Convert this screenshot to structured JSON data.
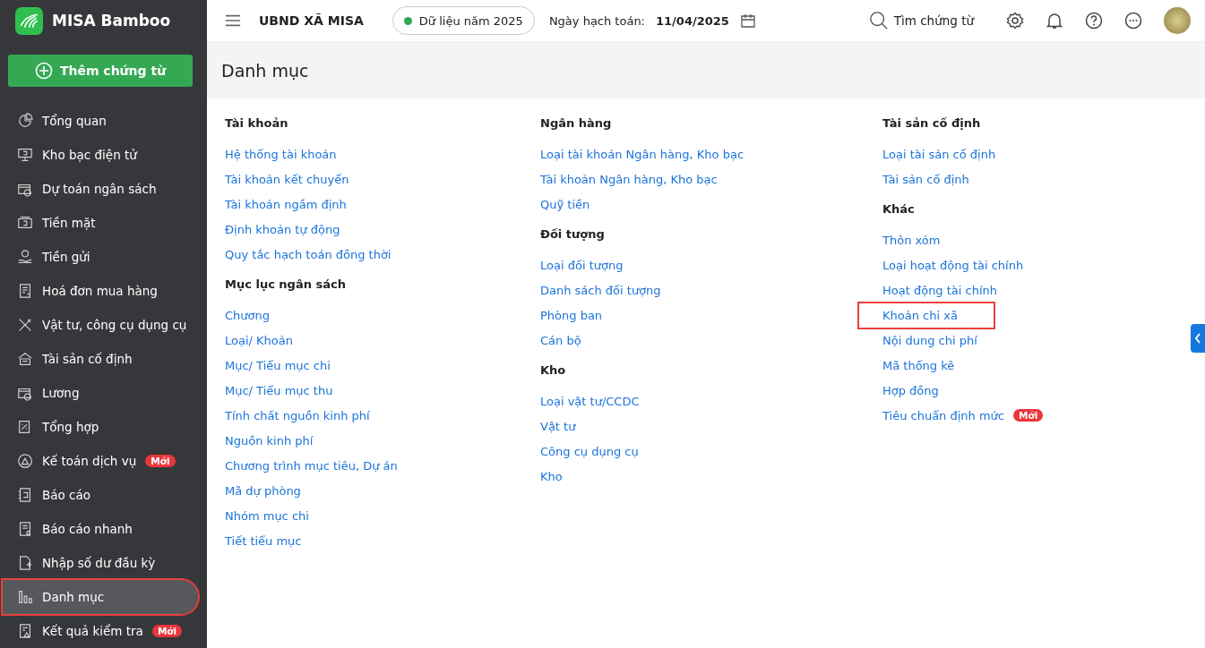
{
  "brand": {
    "name": "MISA Bamboo"
  },
  "add_button": {
    "label": "Thêm chứng từ"
  },
  "sidebar": {
    "items": [
      {
        "label": "Tổng quan",
        "selected": false,
        "highlighted": false
      },
      {
        "label": "Kho bạc điện tử",
        "selected": false,
        "highlighted": false
      },
      {
        "label": "Dự toán ngân sách",
        "selected": false,
        "highlighted": false
      },
      {
        "label": "Tiền mặt",
        "selected": false,
        "highlighted": false
      },
      {
        "label": "Tiền gửi",
        "selected": false,
        "highlighted": false
      },
      {
        "label": "Hoá đơn mua hàng",
        "selected": false,
        "highlighted": false
      },
      {
        "label": "Vật tư, công cụ dụng cụ",
        "selected": false,
        "highlighted": false
      },
      {
        "label": "Tài sản cố định",
        "selected": false,
        "highlighted": false
      },
      {
        "label": "Lương",
        "selected": false,
        "highlighted": false
      },
      {
        "label": "Tổng hợp",
        "selected": false,
        "highlighted": false
      },
      {
        "label": "Kế toán dịch vụ",
        "badge": "Mới",
        "selected": false,
        "highlighted": false
      },
      {
        "label": "Báo cáo",
        "selected": false,
        "highlighted": false
      },
      {
        "label": "Báo cáo nhanh",
        "selected": false,
        "highlighted": false
      },
      {
        "label": "Nhập số dư đầu kỳ",
        "selected": false,
        "highlighted": false
      },
      {
        "label": "Danh mục",
        "selected": true,
        "highlighted": true
      },
      {
        "label": "Kết quả kiểm tra",
        "badge": "Mới",
        "selected": false,
        "highlighted": false
      }
    ]
  },
  "header": {
    "organization": "UBND XÃ MISA",
    "data_year": "Dữ liệu năm 2025",
    "date_label": "Ngày hạch toán:",
    "date_value": "11/04/2025",
    "search_label": "Tìm chứng từ"
  },
  "page_title": "Danh mục",
  "columns": [
    [
      {
        "title": "Tài khoản",
        "links": [
          {
            "label": "Hệ thống tài khoản",
            "highlighted": false
          },
          {
            "label": "Tài khoản kết chuyển",
            "highlighted": false
          },
          {
            "label": "Tài khoản ngầm định",
            "highlighted": false
          },
          {
            "label": "Định khoản tự động",
            "highlighted": false
          },
          {
            "label": "Quy tắc hạch toán đồng thời",
            "highlighted": false
          }
        ]
      },
      {
        "title": "Mục lục ngân sách",
        "links": [
          {
            "label": "Chương",
            "highlighted": false
          },
          {
            "label": "Loại/ Khoản",
            "highlighted": false
          },
          {
            "label": "Mục/ Tiểu mục chi",
            "highlighted": false
          },
          {
            "label": "Mục/ Tiểu mục thu",
            "highlighted": false
          },
          {
            "label": "Tính chất nguồn kinh phí",
            "highlighted": false
          },
          {
            "label": "Nguồn kinh phí",
            "highlighted": false
          },
          {
            "label": "Chương trình mục tiêu, Dự án",
            "highlighted": false
          },
          {
            "label": "Mã dự phòng",
            "highlighted": false
          },
          {
            "label": "Nhóm mục chi",
            "highlighted": false
          },
          {
            "label": "Tiết tiểu mục",
            "highlighted": false
          }
        ]
      }
    ],
    [
      {
        "title": "Ngân hàng",
        "links": [
          {
            "label": "Loại tài khoản Ngân hàng, Kho bạc",
            "highlighted": false
          },
          {
            "label": "Tài khoản Ngân hàng, Kho bạc",
            "highlighted": false
          },
          {
            "label": "Quỹ tiền",
            "highlighted": false
          }
        ]
      },
      {
        "title": "Đối tượng",
        "links": [
          {
            "label": "Loại đối tượng",
            "highlighted": false
          },
          {
            "label": "Danh sách đối tượng",
            "highlighted": false
          },
          {
            "label": "Phòng ban",
            "highlighted": false
          },
          {
            "label": "Cán bộ",
            "highlighted": false
          }
        ]
      },
      {
        "title": "Kho",
        "links": [
          {
            "label": "Loại vật tư/CCDC",
            "highlighted": false
          },
          {
            "label": "Vật tư",
            "highlighted": false
          },
          {
            "label": "Công cụ dụng cụ",
            "highlighted": false
          },
          {
            "label": "Kho",
            "highlighted": false
          }
        ]
      }
    ],
    [
      {
        "title": "Tài sản cố định",
        "links": [
          {
            "label": "Loại tài sản cố định",
            "highlighted": false
          },
          {
            "label": "Tài sản cố định",
            "highlighted": false
          }
        ]
      },
      {
        "title": "Khác",
        "links": [
          {
            "label": "Thôn xóm",
            "highlighted": false
          },
          {
            "label": "Loại hoạt động tài chính",
            "highlighted": false
          },
          {
            "label": "Hoạt động tài chính",
            "highlighted": false
          },
          {
            "label": "Khoản chi xã",
            "highlighted": true
          },
          {
            "label": "Nội dung chi phí",
            "highlighted": false
          },
          {
            "label": "Mã thống kê",
            "highlighted": false
          },
          {
            "label": "Hợp đồng",
            "highlighted": false
          },
          {
            "label": "Tiêu chuẩn định mức",
            "badge": "Mới",
            "highlighted": false
          }
        ]
      }
    ]
  ]
}
